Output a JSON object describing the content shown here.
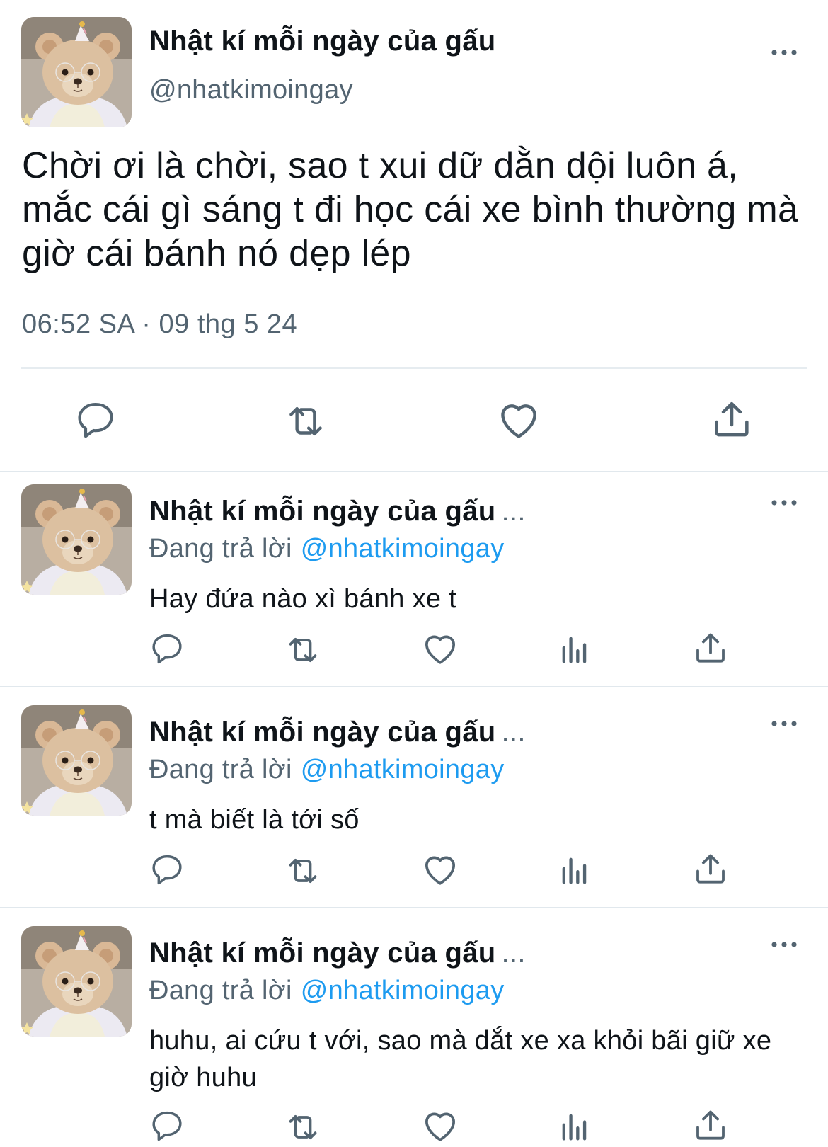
{
  "main_tweet": {
    "author_name": "Nhật kí mỗi ngày của gấu",
    "handle": "@nhatkimoingay",
    "text": "Chời ơi là chời, sao t xui dữ dằn dội luôn á, mắc cái gì sáng t đi học cái xe bình thường mà giờ cái bánh nó dẹp lép",
    "timestamp": "06:52 SA · 09 thg 5 24",
    "actions": [
      "reply-icon",
      "retweet-icon",
      "like-icon",
      "share-icon"
    ]
  },
  "replies": [
    {
      "author_name": "Nhật kí mỗi ngày của gấu",
      "ellipsis": "...",
      "replying_label": "Đang trả lời",
      "mention": "@nhatkimoingay",
      "text": "Hay đứa nào xì bánh xe t"
    },
    {
      "author_name": "Nhật kí mỗi ngày của gấu",
      "ellipsis": "...",
      "replying_label": "Đang trả lời",
      "mention": "@nhatkimoingay",
      "text": "t mà biết là tới số"
    },
    {
      "author_name": "Nhật kí mỗi ngày của gấu",
      "ellipsis": "...",
      "replying_label": "Đang trả lời",
      "mention": "@nhatkimoingay",
      "text": "huhu, ai cứu t với, sao mà dắt xe xa khỏi bãi giữ xe giờ huhu"
    }
  ],
  "reply_actions": [
    "reply-icon",
    "retweet-icon",
    "like-icon",
    "analytics-icon",
    "share-icon"
  ],
  "colors": {
    "text": "#0f1419",
    "secondary": "#536471",
    "link": "#1d9bf0",
    "divider": "#e1e8ed"
  }
}
